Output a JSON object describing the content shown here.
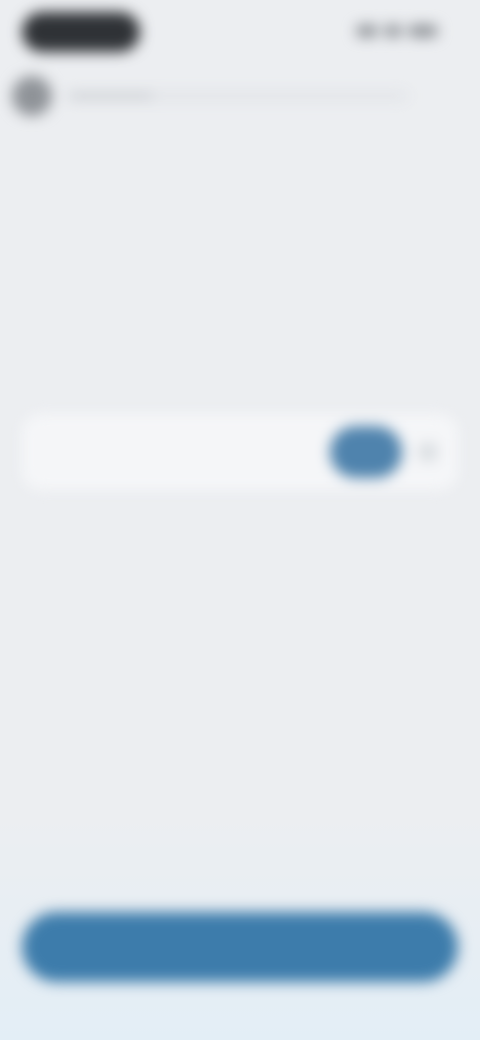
{
  "status_bar": {
    "time": "",
    "right_icons": [
      "signal-icon",
      "wifi-icon",
      "battery-icon"
    ]
  },
  "header": {
    "back_icon": "back-arrow-icon",
    "progress_fraction": 0.25,
    "step_count": ""
  },
  "question": {
    "eyebrow": "",
    "title": ""
  },
  "input": {
    "value": "",
    "placeholder": "",
    "inline_button_label": ""
  },
  "cta": {
    "label": ""
  },
  "colors": {
    "background": "#eceef1",
    "accent": "#3d7cab",
    "inline_button": "#4f83ad"
  }
}
